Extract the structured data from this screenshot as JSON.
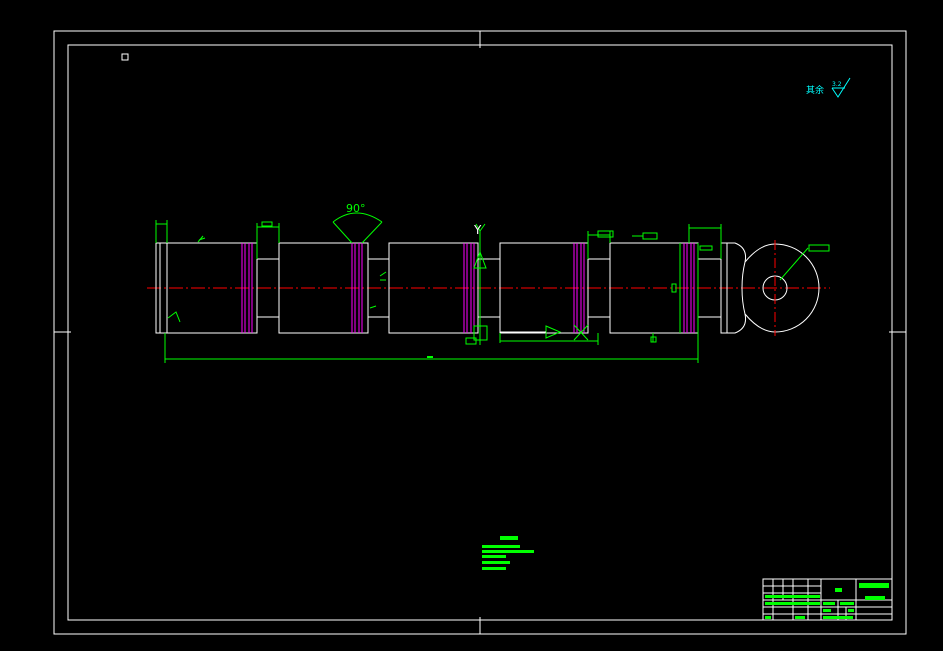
{
  "drawing": {
    "angle_label": "90°",
    "datum_label": "Y",
    "roughness_note": "其余",
    "roughness_value": "3.2"
  },
  "colors": {
    "background": "#000000",
    "outline": "#ffffff",
    "dimension": "#00ff00",
    "centerline": "#ff0000",
    "groove": "#ff00ff",
    "note": "#00ffff"
  },
  "icons": {
    "roughness_symbol": "surface-roughness-icon",
    "datum_symbol": "datum-triangle-icon",
    "ucs_marker": "ucs-square-icon"
  }
}
